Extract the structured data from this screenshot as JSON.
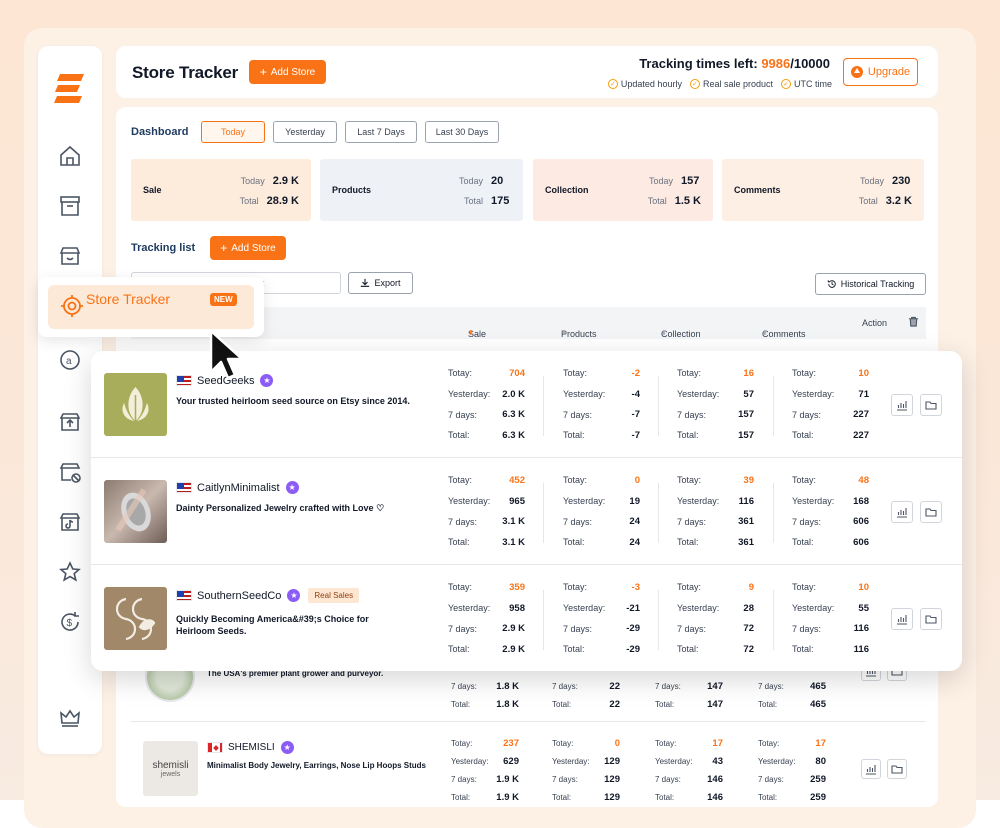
{
  "header": {
    "title": "Store Tracker",
    "add_store": "Add Store",
    "tracking_label": "Tracking times left:",
    "tracking_used": "9986",
    "tracking_total": "/10000",
    "features": [
      "Updated hourly",
      "Real sale product",
      "UTC time"
    ],
    "upgrade": "Upgrade"
  },
  "sidebar": {
    "popup_label": "Store Tracker",
    "popup_badge": "NEW"
  },
  "dashboard": {
    "title": "Dashboard",
    "tabs": [
      "Today",
      "Yesterday",
      "Last 7 Days",
      "Last 30 Days"
    ],
    "stats": [
      {
        "name": "Sale",
        "today_label": "Today",
        "today": "2.9 K",
        "total_label": "Total",
        "total": "28.9 K"
      },
      {
        "name": "Products",
        "today_label": "Today",
        "today": "20",
        "total_label": "Total",
        "total": "175"
      },
      {
        "name": "Collection",
        "today_label": "Today",
        "today": "157",
        "total_label": "Total",
        "total": "1.5 K"
      },
      {
        "name": "Comments",
        "today_label": "Today",
        "today": "230",
        "total_label": "Total",
        "total": "3.2 K"
      }
    ]
  },
  "tracking": {
    "title": "Tracking list",
    "add_store": "Add Store",
    "search_placeholder": "k",
    "export": "Export",
    "historical": "Historical Tracking",
    "columns": {
      "sale": "Sale",
      "products": "Products",
      "collection": "Collection",
      "comments": "Comments",
      "action": "Action"
    }
  },
  "labels": {
    "today": "Totay:",
    "yesterday": "Yesterday:",
    "days7": "7 days:",
    "total": "Total:"
  },
  "stores": [
    {
      "name": "SeedGeeks",
      "desc": "Your trusted heirloom seed source on Etsy since 2014.",
      "badge": "",
      "sale": [
        "704",
        "2.0 K",
        "6.3 K",
        "6.3 K"
      ],
      "products": [
        "-2",
        "-4",
        "-7",
        "-7"
      ],
      "collection": [
        "16",
        "57",
        "157",
        "157"
      ],
      "comments": [
        "10",
        "71",
        "227",
        "227"
      ]
    },
    {
      "name": "CaitlynMinimalist",
      "desc": "Dainty Personalized Jewelry crafted with Love ♡",
      "badge": "",
      "sale": [
        "452",
        "965",
        "3.1 K",
        "3.1 K"
      ],
      "products": [
        "0",
        "19",
        "24",
        "24"
      ],
      "collection": [
        "39",
        "116",
        "361",
        "361"
      ],
      "comments": [
        "48",
        "168",
        "606",
        "606"
      ]
    },
    {
      "name": "SouthernSeedCo",
      "desc": "Quickly Becoming America&#39;s Choice for Heirloom Seeds.",
      "badge": "Real Sales",
      "sale": [
        "359",
        "958",
        "2.9 K",
        "2.9 K"
      ],
      "products": [
        "-3",
        "-21",
        "-29",
        "-29"
      ],
      "collection": [
        "9",
        "28",
        "72",
        "72"
      ],
      "comments": [
        "10",
        "55",
        "116",
        "116"
      ]
    }
  ],
  "bg_rows": [
    {
      "desc": "The USA's premier plant grower and purveyor.",
      "sale": [
        "1.8 K",
        "1.8 K"
      ],
      "products": [
        "22",
        "22"
      ],
      "collection": [
        "147",
        "147"
      ],
      "comments": [
        "465",
        "465"
      ]
    },
    {
      "name": "SHEMISLI",
      "thumb_text": "shemisli",
      "thumb_sub": "jewels",
      "desc": "Minimalist Body Jewelry, Earrings, Nose Lip Hoops Studs",
      "sale": [
        "237",
        "629",
        "1.9 K",
        "1.9 K"
      ],
      "products": [
        "0",
        "129",
        "129",
        "129"
      ],
      "collection": [
        "17",
        "43",
        "146",
        "146"
      ],
      "comments": [
        "17",
        "80",
        "259",
        "259"
      ]
    }
  ]
}
